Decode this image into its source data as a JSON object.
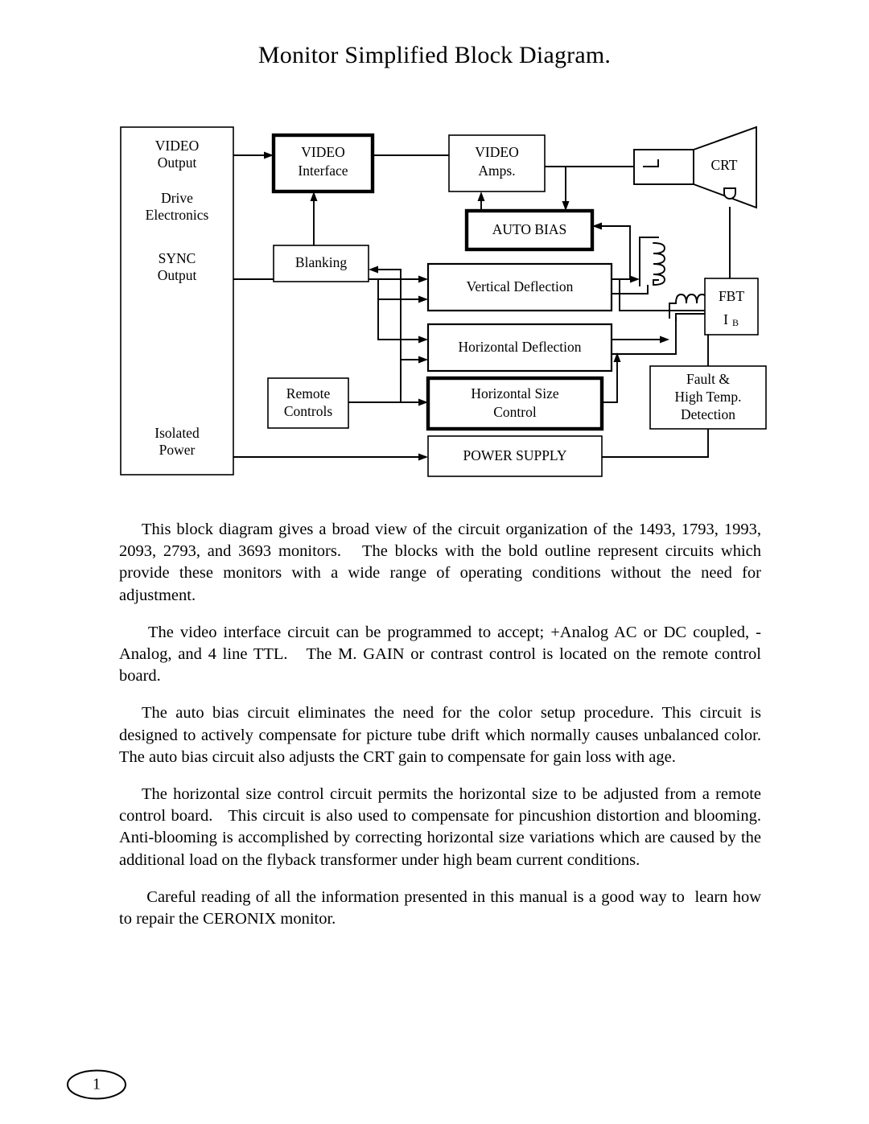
{
  "document": {
    "title": "Monitor Simplified Block Diagram.",
    "page_number": "1"
  },
  "diagram": {
    "name": "monitor-simplified-block-diagram",
    "blocks": {
      "drive_electronics": {
        "lines": [
          "VIDEO",
          "Output",
          "Drive",
          "Electronics",
          "SYNC",
          "Output",
          "Isolated",
          "Power"
        ],
        "video_output_1": "VIDEO",
        "video_output_2": "Output",
        "drive_1": "Drive",
        "drive_2": "Electronics",
        "sync_1": "SYNC",
        "sync_2": "Output",
        "isolated_1": "Isolated",
        "isolated_2": "Power",
        "outline": "thin"
      },
      "video_interface": {
        "line1": "VIDEO",
        "line2": "Interface",
        "outline": "bold"
      },
      "video_amps": {
        "line1": "VIDEO",
        "line2": "Amps.",
        "outline": "thin"
      },
      "blanking": {
        "line1": "Blanking",
        "outline": "thin"
      },
      "auto_bias": {
        "line1": "AUTO BIAS",
        "outline": "bold"
      },
      "vertical_deflection": {
        "line1": "Vertical Deflection",
        "outline": "medium"
      },
      "horizontal_deflection": {
        "line1": "Horizontal Deflection",
        "outline": "medium"
      },
      "remote_controls": {
        "line1": "Remote",
        "line2": "Controls",
        "outline": "thin"
      },
      "horizontal_size_control": {
        "line1": "Horizontal Size",
        "line2": "Control",
        "outline": "bold"
      },
      "fault_high_temp": {
        "line1": "Fault &",
        "line2": "High Temp.",
        "line3": "Detection",
        "outline": "thin"
      },
      "power_supply": {
        "line1": "POWER SUPPLY",
        "outline": "thin"
      },
      "crt": {
        "label": "CRT",
        "outline": "thin"
      },
      "fbt": {
        "line1": "FBT",
        "line2_main": "I",
        "line2_sub": "B",
        "outline": "thin"
      }
    },
    "symbols": {
      "vertical_deflection_coil": "coil-vertical",
      "horizontal_deflection_coil": "coil-horizontal",
      "crt_anode": "crt-anode-connector",
      "crt_cathode": "crt-cathode"
    }
  },
  "paragraphs": [
    "This block diagram gives a broad view of the circuit organization of the 1493, 1793, 1993, 2093, 2793, and 3693 monitors.   The blocks with the bold outline represent circuits which provide these monitors with a wide range of operating conditions without the need for adjustment.",
    " The video interface circuit can be programmed to accept; +Analog AC or DC coupled, -Analog, and 4 line TTL.   The M. GAIN or contrast control is located on the remote control board.",
    "The auto bias circuit eliminates the need for the color setup procedure. This circuit is designed to actively compensate for picture tube drift which normally causes unbalanced color.  The auto bias circuit also adjusts the CRT gain to compensate for gain loss with age.",
    "The horizontal size control circuit permits the horizontal size to be adjusted from a remote control board.   This circuit is also used to compensate for pincushion distortion and blooming.  Anti-blooming is accomplished by correcting horizontal size variations which are caused by the additional load on the flyback transformer under high beam current conditions.",
    " Careful reading of all the information presented in this manual is a good way to  learn how to repair the CERONIX monitor."
  ],
  "colors": {
    "page_background": "#ffffff",
    "ink": "#000000"
  }
}
